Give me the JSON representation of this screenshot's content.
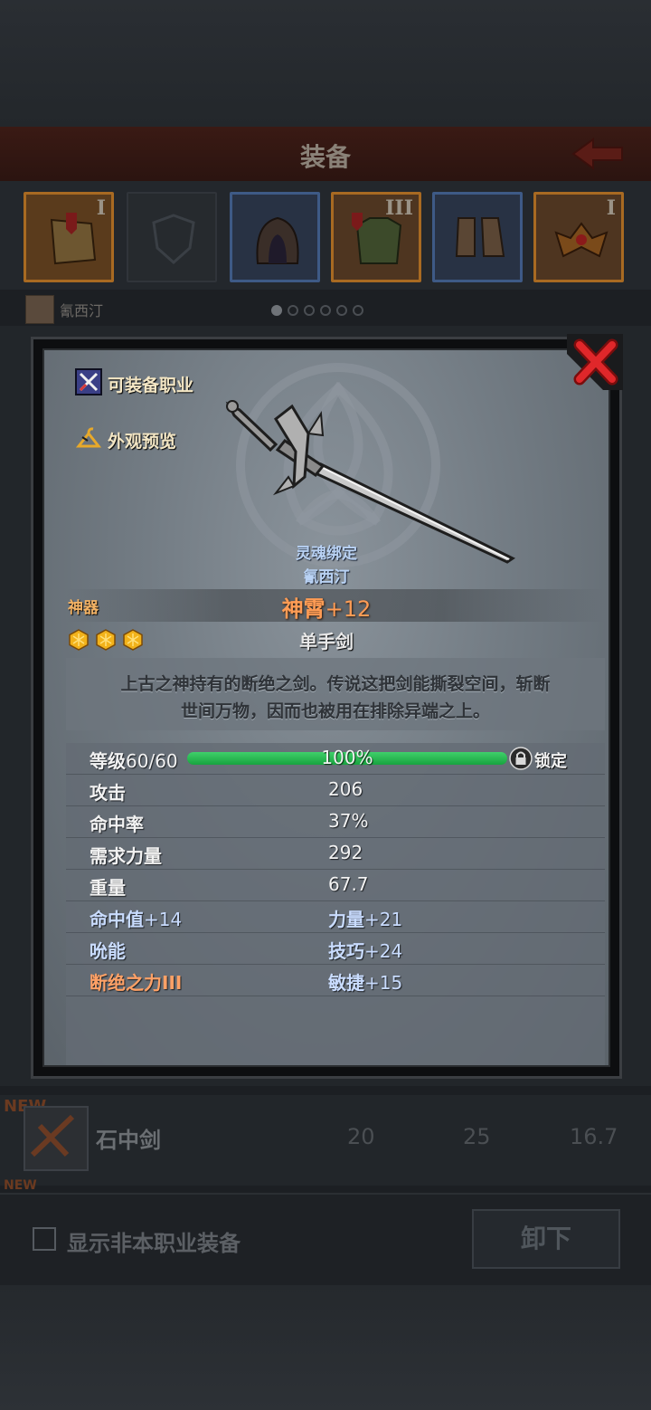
{
  "screen": {
    "title": "装备",
    "character_name": "氰西汀",
    "checkbox_label": "显示非本职业装备",
    "unequip_label": "卸下",
    "new_tag": "NEW",
    "list_item": {
      "name": "石中剑",
      "col1": "20",
      "col2": "25",
      "col3": "16.7"
    },
    "slot_tiers": [
      "I",
      "",
      "",
      "III",
      "",
      "I"
    ]
  },
  "dialog": {
    "links": {
      "usable_class": "可装备职业",
      "appearance_preview": "外观预览"
    },
    "soul_bind": "灵魂绑定",
    "soul_owner": "氰西汀",
    "rarity": "神器",
    "item_name": "神霄",
    "item_enhance": "+12",
    "item_type": "单手剑",
    "description_line1": "上古之神持有的断绝之剑。传说这把剑能撕裂空间，斩断",
    "description_line2": "世间万物，因而也被用在排除异端之上。",
    "level": {
      "label": "等级",
      "value_text": "60/60",
      "progress_text": "100%",
      "progress": 1.0,
      "lock_label": "锁定"
    },
    "stats": [
      {
        "label": "攻击",
        "value": "206"
      },
      {
        "label": "命中率",
        "value": "37%"
      },
      {
        "label": "需求力量",
        "value": "292"
      },
      {
        "label": "重量",
        "value": "67.7"
      }
    ],
    "bonuses": [
      {
        "left_name": "命中值",
        "left_num": "+14",
        "right_name": "力量",
        "right_num": "+21"
      },
      {
        "left_name": "吮能",
        "left_num": "",
        "right_name": "技巧",
        "right_num": "+24"
      },
      {
        "left_name": "断绝之力III",
        "left_num": "",
        "right_name": "敏捷",
        "right_num": "+15"
      }
    ]
  },
  "colors": {
    "artifact_orange": "#ff9c55",
    "bonus_blue": "#c9dcff",
    "progress_green": "#2fbf55",
    "close_red": "#d8262a"
  }
}
